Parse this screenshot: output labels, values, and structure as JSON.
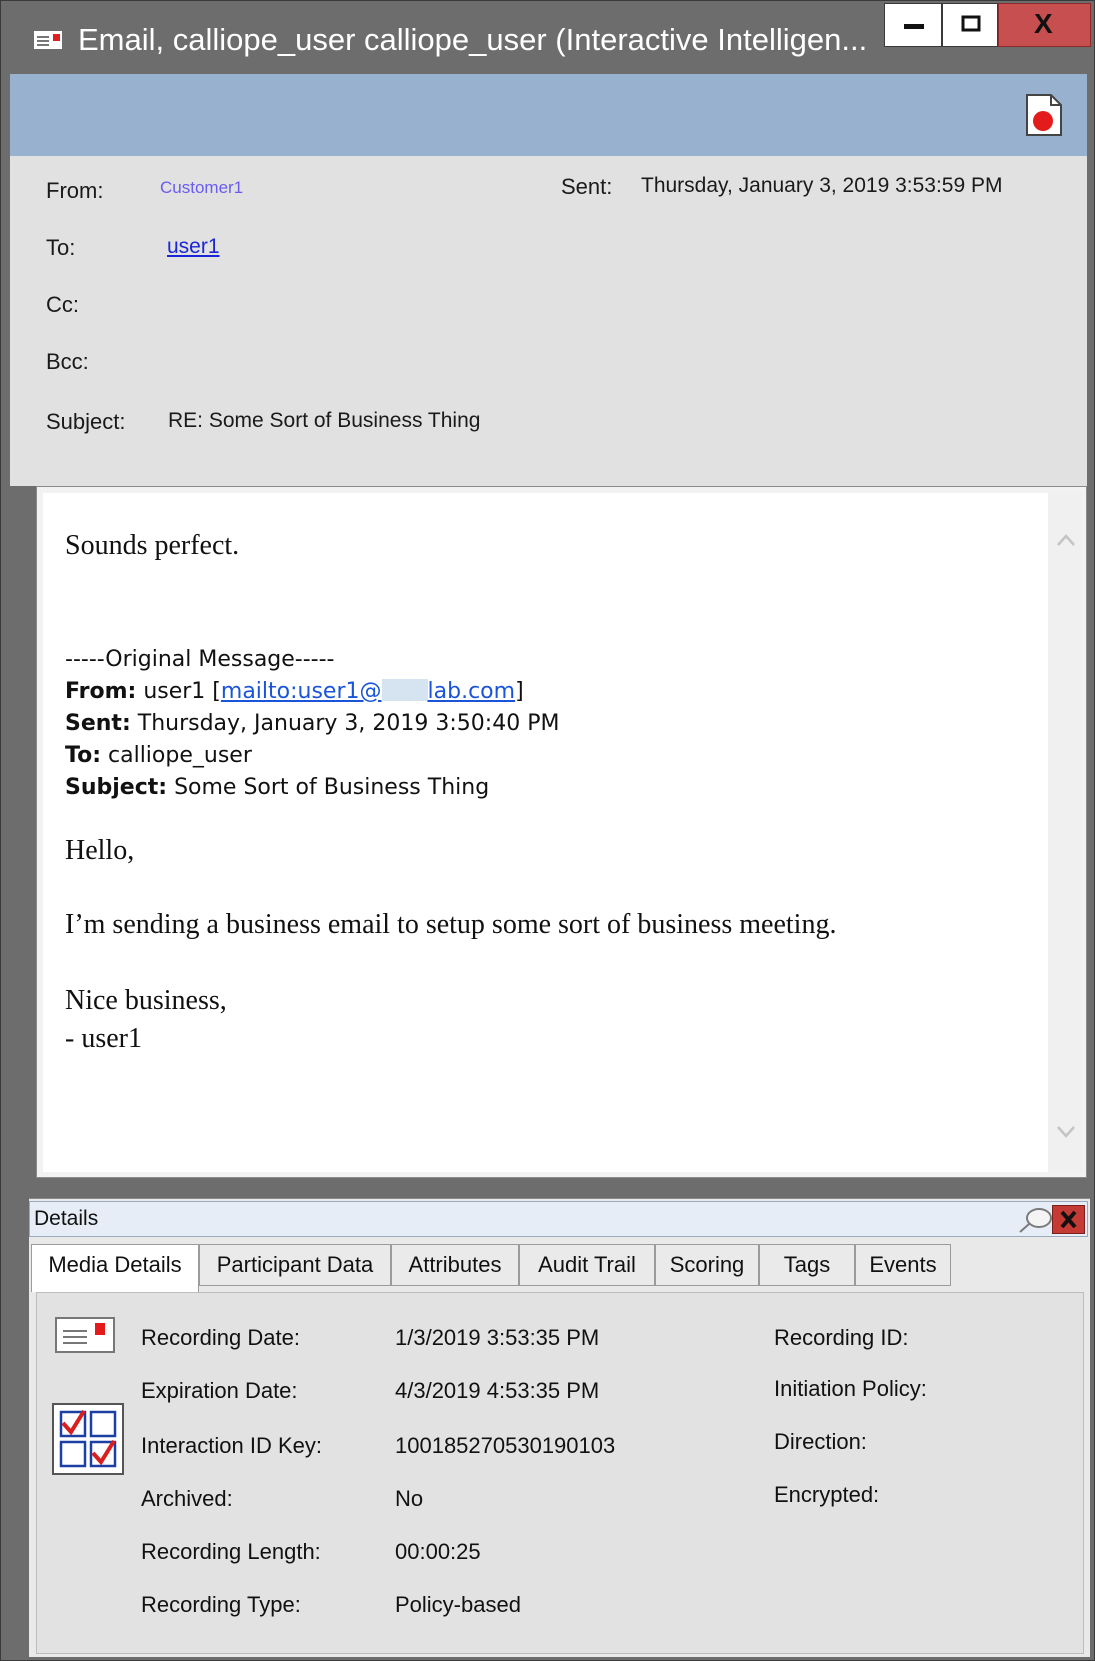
{
  "window": {
    "title": "Email, calliope_user calliope_user (Interactive Intelligen...",
    "controls": {
      "minimize": "minimize",
      "maximize": "maximize",
      "close": "X"
    }
  },
  "header": {
    "from_label": "From:",
    "from_value": "Customer1",
    "sent_label": "Sent:",
    "sent_value": "Thursday, January 3, 2019 3:53:59 PM",
    "to_label": "To:",
    "to_value": "user1",
    "cc_label": "Cc:",
    "bcc_label": "Bcc:",
    "subject_label": "Subject:",
    "subject_value": "RE: Some Sort of Business Thing"
  },
  "message": {
    "reply_line": "Sounds perfect.",
    "original_header": "-----Original Message-----",
    "orig_from_label": "From:",
    "orig_from_name": "user1",
    "orig_from_link_start": "mailto:user1@",
    "orig_from_link_end": "lab.com",
    "orig_sent_label": "Sent:",
    "orig_sent_value": "Thursday, January 3, 2019 3:50:40 PM",
    "orig_to_label": "To:",
    "orig_to_value": "calliope_user",
    "orig_subject_label": "Subject:",
    "orig_subject_value": "Some Sort of Business Thing",
    "greeting": "Hello,",
    "body": "I’m sending a business email to setup some sort of business meeting.",
    "closing": "Nice business,",
    "signature": "- user1"
  },
  "details": {
    "title": "Details",
    "tabs": [
      "Media Details",
      "Participant Data",
      "Attributes",
      "Audit Trail",
      "Scoring",
      "Tags",
      "Events"
    ],
    "active_tab": "Media Details",
    "fields": [
      {
        "label": "Recording Date:",
        "value": "1/3/2019 3:53:35 PM"
      },
      {
        "label": "Expiration Date:",
        "value": "4/3/2019 4:53:35 PM"
      },
      {
        "label": "Interaction ID Key:",
        "value": "100185270530190103"
      },
      {
        "label": "Archived:",
        "value": "No"
      },
      {
        "label": "Recording Length:",
        "value": "00:00:25"
      },
      {
        "label": "Recording Type:",
        "value": "Policy-based"
      }
    ],
    "right_labels": [
      "Recording ID:",
      "Initiation Policy:",
      "Direction:",
      "Encrypted:"
    ]
  },
  "colors": {
    "titlebar": "#6d6d6d",
    "close_button": "#c74f4f",
    "blue_band": "#98b1cf",
    "header_bg": "#e1e1e1",
    "link": "#1a55d9"
  },
  "icons": [
    "email-window-icon",
    "record-document-icon",
    "scroll-up-icon",
    "scroll-down-icon",
    "pin-icon",
    "close-icon",
    "email-media-icon",
    "checklist-icon"
  ]
}
